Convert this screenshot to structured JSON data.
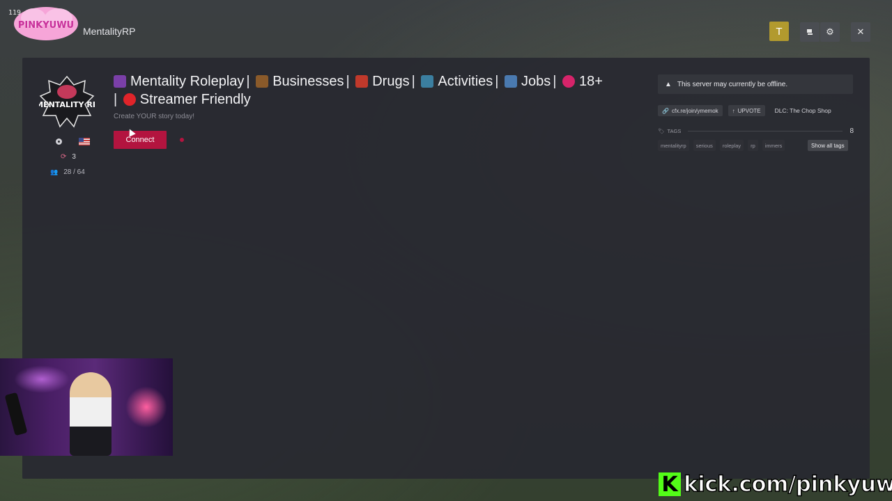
{
  "overlay": {
    "fps": "119 p",
    "streamer_logo_text": "PINKYUWU",
    "kick_url": "kick.com/pinkyuwu",
    "kick_badge": "K"
  },
  "header": {
    "server_name": "MentalityRP",
    "user_initial": "T",
    "icons": [
      "copy-icon",
      "gear-icon",
      "close-icon"
    ],
    "close_glyph": "✕",
    "gear_glyph": "⚙"
  },
  "server": {
    "logo_text": "MENTALITY RP",
    "title_segments": [
      {
        "emoji_color": "#7a3fa8",
        "text": "Mentality Roleplay"
      },
      {
        "emoji_color": "#8a5a2a",
        "text": "Businesses"
      },
      {
        "emoji_color": "#c0392b",
        "text": "Drugs"
      },
      {
        "emoji_color": "#3b7fa0",
        "text": "Activities"
      },
      {
        "emoji_color": "#4a7ab0",
        "text": "Jobs"
      },
      {
        "emoji_color": "#d6246a",
        "text": "18+"
      },
      {
        "emoji_color": "#e0242a",
        "text": "Streamer Friendly"
      }
    ],
    "separator": "|",
    "tagline": "Create YOUR story today!",
    "boosts": "3",
    "players": "28 / 64",
    "connect_label": "Connect"
  },
  "sidebar": {
    "warning": "This server may currently be offline.",
    "join_link": "cfx.re/join/ymemok",
    "upvote": "UPVOTE",
    "dlc": "DLC: The Chop Shop",
    "tags_label": "TAGS",
    "tags_count": "8",
    "tags": [
      "mentalityrp",
      "serious",
      "roleplay",
      "rp",
      "immers"
    ],
    "show_all_label": "Show all tags"
  },
  "colors": {
    "accent": "#b3143f",
    "user_badge": "#b29a2e",
    "kick_green": "#53fc18"
  }
}
